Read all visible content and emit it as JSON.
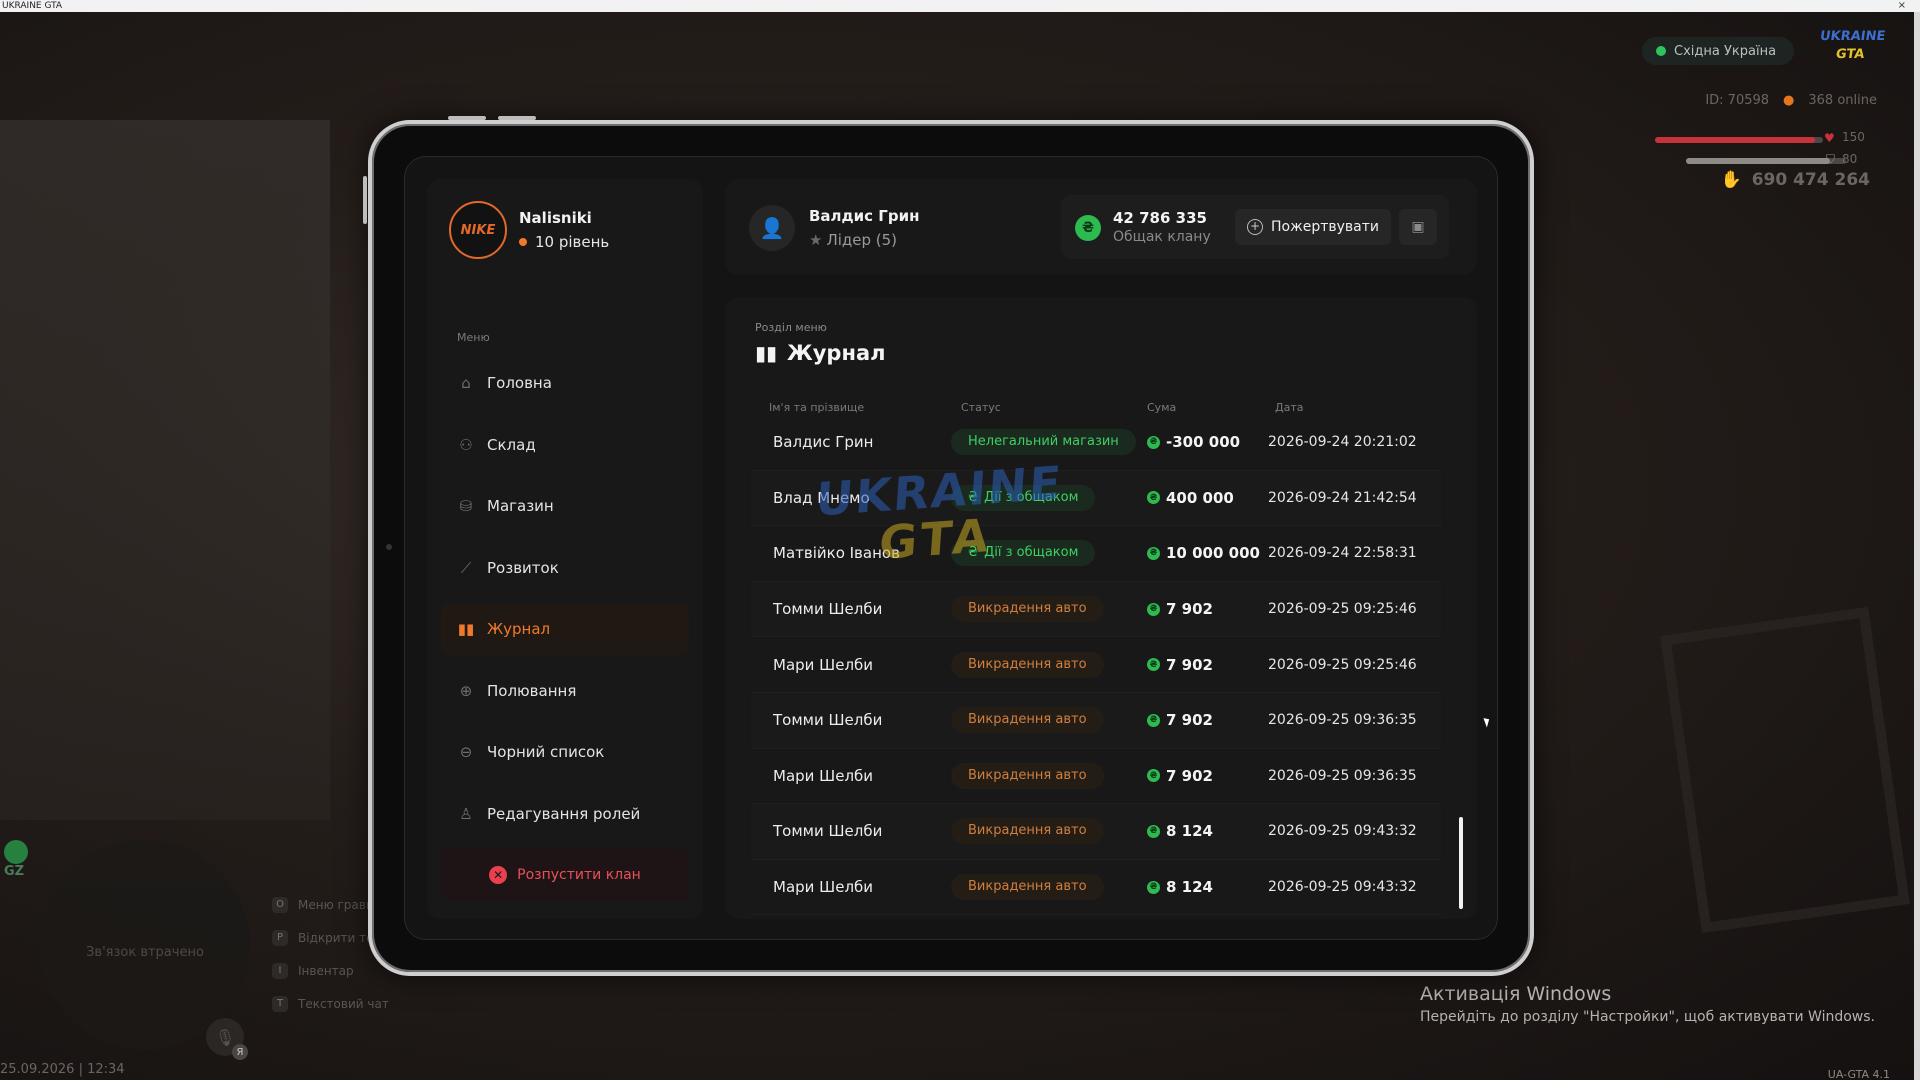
{
  "window": {
    "title": "UKRAINE GTA",
    "close": "×"
  },
  "hud": {
    "region": "Східна Україна",
    "logo_top": "UKRAINE",
    "logo_bottom": "GTA",
    "player_id": "ID: 70598",
    "online": "368 online",
    "health": 150,
    "armor": 80,
    "health_fill": 0.95,
    "armor_fill": 0.9,
    "money": "690 474 264",
    "minimap_status": "Зв'язок втрачено",
    "gz_label": "GZ",
    "keys": [
      {
        "key": "O",
        "label": "Меню гравця"
      },
      {
        "key": "P",
        "label": "Відкрити телефон"
      },
      {
        "key": "I",
        "label": "Інвентар"
      },
      {
        "key": "T",
        "label": "Текстовий чат"
      }
    ],
    "voice_key": "Я",
    "datetime": "25.09.2026 | 12:34",
    "version": "UA-GTA 4.1"
  },
  "windows_activation": {
    "title": "Активація Windows",
    "subtitle": "Перейдіть до розділу \"Настройки\", щоб активувати Windows."
  },
  "profile": {
    "avatar": "NIKE",
    "name": "Nalisniki",
    "level": "10 рівень"
  },
  "menu": {
    "label": "Меню",
    "items": [
      {
        "label": "Головна",
        "icon": "home-icon",
        "glyph": "⌂",
        "active": false
      },
      {
        "label": "Склад",
        "icon": "warehouse-icon",
        "glyph": "⚇",
        "active": false
      },
      {
        "label": "Магазин",
        "icon": "shop-icon",
        "glyph": "⛁",
        "active": false
      },
      {
        "label": "Розвиток",
        "icon": "chart-icon",
        "glyph": "⟋",
        "active": false
      },
      {
        "label": "Журнал",
        "icon": "book-icon",
        "glyph": "▮▮",
        "active": true
      },
      {
        "label": "Полювання",
        "icon": "crosshair-icon",
        "glyph": "⊕",
        "active": false
      },
      {
        "label": "Чорний список",
        "icon": "block-icon",
        "glyph": "⊖",
        "active": false
      },
      {
        "label": "Редагування ролей",
        "icon": "user-role-icon",
        "glyph": "♙",
        "active": false
      }
    ],
    "disband": "Розпустити клан"
  },
  "leader": {
    "name": "Валдис Грин",
    "role": "Лідер (5)"
  },
  "bank": {
    "amount": "42 786 335",
    "label": "Общак клану",
    "donate": "Пожертвувати"
  },
  "journal": {
    "section_label": "Розділ меню",
    "title": "Журнал",
    "columns": {
      "name": "Ім'я та прізвище",
      "status": "Статус",
      "sum": "Сума",
      "date": "Дата"
    },
    "rows": [
      {
        "name": "Валдис Грин",
        "status": "Нелегальний магазин",
        "status_color": "green",
        "status_icon": "",
        "sum": "-300 000",
        "date": "2026-09-24 20:21:02"
      },
      {
        "name": "Влад Мнемо",
        "status": "Дії з общаком",
        "status_color": "green",
        "status_icon": "₴",
        "sum": "400 000",
        "date": "2026-09-24 21:42:54"
      },
      {
        "name": "Матвійко Іванов",
        "status": "Дії з общаком",
        "status_color": "green",
        "status_icon": "₴",
        "sum": "10 000 000",
        "date": "2026-09-24 22:58:31"
      },
      {
        "name": "Томми Шелби",
        "status": "Викрадення авто",
        "status_color": "orange",
        "status_icon": "",
        "sum": "7 902",
        "date": "2026-09-25 09:25:46"
      },
      {
        "name": "Мари Шелби",
        "status": "Викрадення авто",
        "status_color": "orange",
        "status_icon": "",
        "sum": "7 902",
        "date": "2026-09-25 09:25:46"
      },
      {
        "name": "Томми Шелби",
        "status": "Викрадення авто",
        "status_color": "orange",
        "status_icon": "",
        "sum": "7 902",
        "date": "2026-09-25 09:36:35"
      },
      {
        "name": "Мари Шелби",
        "status": "Викрадення авто",
        "status_color": "orange",
        "status_icon": "",
        "sum": "7 902",
        "date": "2026-09-25 09:36:35"
      },
      {
        "name": "Томми Шелби",
        "status": "Викрадення авто",
        "status_color": "orange",
        "status_icon": "",
        "sum": "8 124",
        "date": "2026-09-25 09:43:32"
      },
      {
        "name": "Мари Шелби",
        "status": "Викрадення авто",
        "status_color": "orange",
        "status_icon": "",
        "sum": "8 124",
        "date": "2026-09-25 09:43:32"
      }
    ]
  },
  "colors": {
    "accent": "#f07a2c",
    "money_green": "#2dbb4f",
    "danger": "#e8414d"
  }
}
